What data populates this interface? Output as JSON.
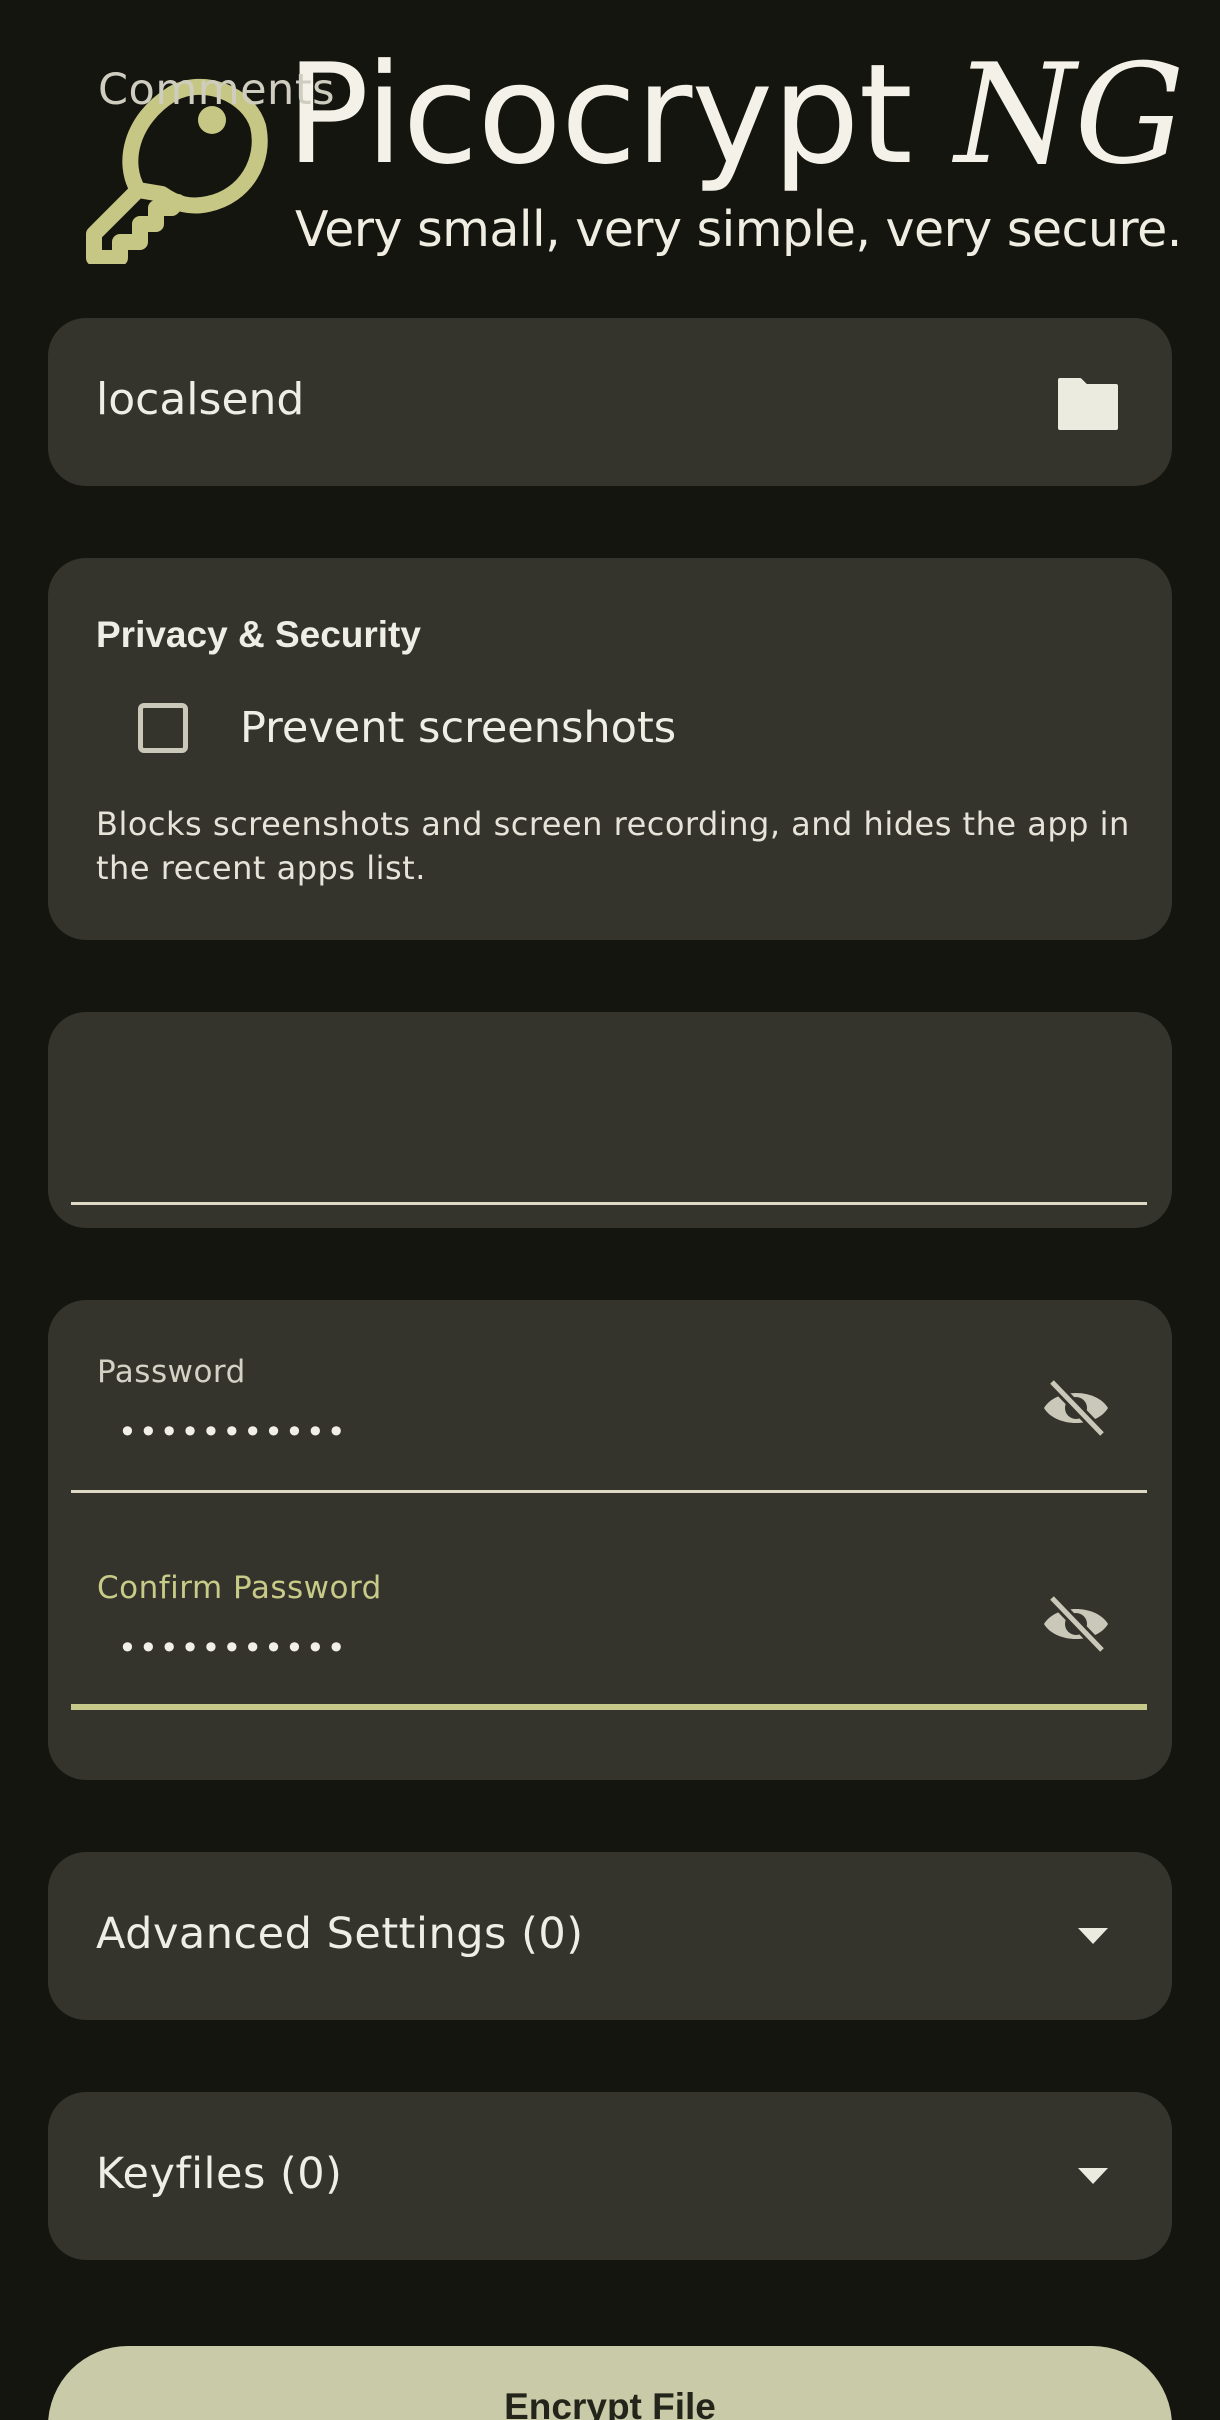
{
  "header": {
    "title_main": "Picocrypt ",
    "title_suffix": "NG",
    "tagline": "Very small, very simple, very secure.",
    "logo_icon": "key-icon",
    "accent_color": "#c6c784"
  },
  "file_picker": {
    "value": "localsend",
    "icon": "folder-icon"
  },
  "privacy": {
    "title": "Privacy & Security",
    "checkbox_label": "Prevent screenshots",
    "checkbox_checked": false,
    "description": "Blocks screenshots and screen recording, and hides the app in the recent apps list."
  },
  "comments": {
    "placeholder": "Comments",
    "value": ""
  },
  "password": {
    "label": "Password",
    "value": "•••••••••••",
    "visibility_icon": "eye-off-icon"
  },
  "confirm_password": {
    "label": "Confirm Password",
    "value": "•••••••••••",
    "visibility_icon": "eye-off-icon",
    "focused": true
  },
  "advanced_settings": {
    "label": "Advanced Settings (0)",
    "icon": "dropdown-arrow-icon"
  },
  "keyfiles": {
    "label": "Keyfiles (0)",
    "icon": "dropdown-arrow-icon"
  },
  "actions": {
    "encrypt_label": "Encrypt File"
  }
}
